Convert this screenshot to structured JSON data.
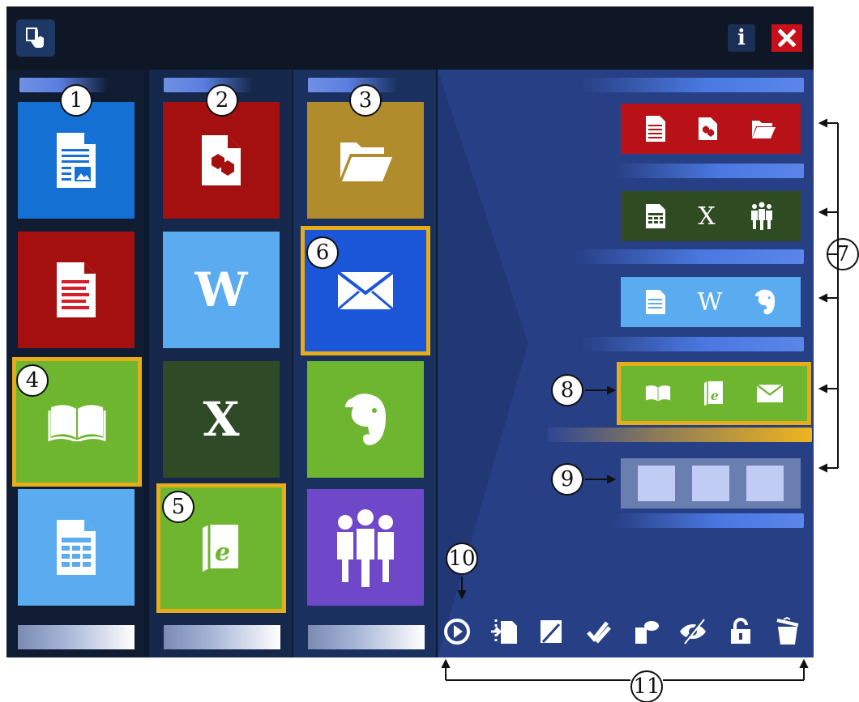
{
  "window": {
    "info_label": "i",
    "close_label": "✖",
    "app_icon": "pointer-hand-icon"
  },
  "columns": [
    {
      "tiles": [
        {
          "icon": "document-picture-icon",
          "color": "#1570d4"
        },
        {
          "icon": "pdf-document-icon",
          "color": "#a41010"
        },
        {
          "icon": "open-book-icon",
          "color": "#6eb530",
          "selected": true
        },
        {
          "icon": "spreadsheet-document-icon",
          "color": "#5aabef"
        }
      ]
    },
    {
      "tiles": [
        {
          "icon": "hexagon-document-icon",
          "color": "#a41010"
        },
        {
          "label": "W",
          "color": "#5aabef"
        },
        {
          "label": "X",
          "color": "#2e4a26"
        },
        {
          "icon": "ebook-icon",
          "color": "#6eb530",
          "selected": true
        }
      ]
    },
    {
      "tiles": [
        {
          "icon": "folder-open-icon",
          "color": "#b08c2c"
        },
        {
          "icon": "envelope-icon",
          "color": "#1b55d8",
          "selected": true
        },
        {
          "icon": "evernote-elephant-icon",
          "color": "#6eb530"
        },
        {
          "icon": "people-group-icon",
          "color": "#6e48c8"
        }
      ]
    }
  ],
  "groups": [
    {
      "color": "#b81118",
      "items": [
        "pdf-document-icon",
        "hexagon-document-icon",
        "folder-open-icon"
      ]
    },
    {
      "color": "#2f4b22",
      "items": [
        "spreadsheet-document-icon",
        "X",
        "people-group-icon"
      ]
    },
    {
      "color": "#5aabef",
      "items": [
        "text-document-icon",
        "W",
        "evernote-elephant-icon"
      ]
    },
    {
      "color": "#6eb530",
      "items": [
        "open-book-icon",
        "ebook-icon",
        "envelope-icon"
      ],
      "selected": true
    },
    {
      "color": "#6a7eb0",
      "items": [
        "empty",
        "empty",
        "empty"
      ]
    }
  ],
  "toolbar": [
    "play-circle-icon",
    "move-document-icon",
    "edit-pencil-icon",
    "check-pencil-icon",
    "tag-document-icon",
    "hide-eye-icon",
    "unlock-icon",
    "trash-icon"
  ],
  "callouts": {
    "c1": "1",
    "c2": "2",
    "c3": "3",
    "c4": "4",
    "c5": "5",
    "c6": "6",
    "c7": "7",
    "c8": "8",
    "c9": "9",
    "c10": "10",
    "c11": "11"
  },
  "accent_color": "#e6ac1c"
}
